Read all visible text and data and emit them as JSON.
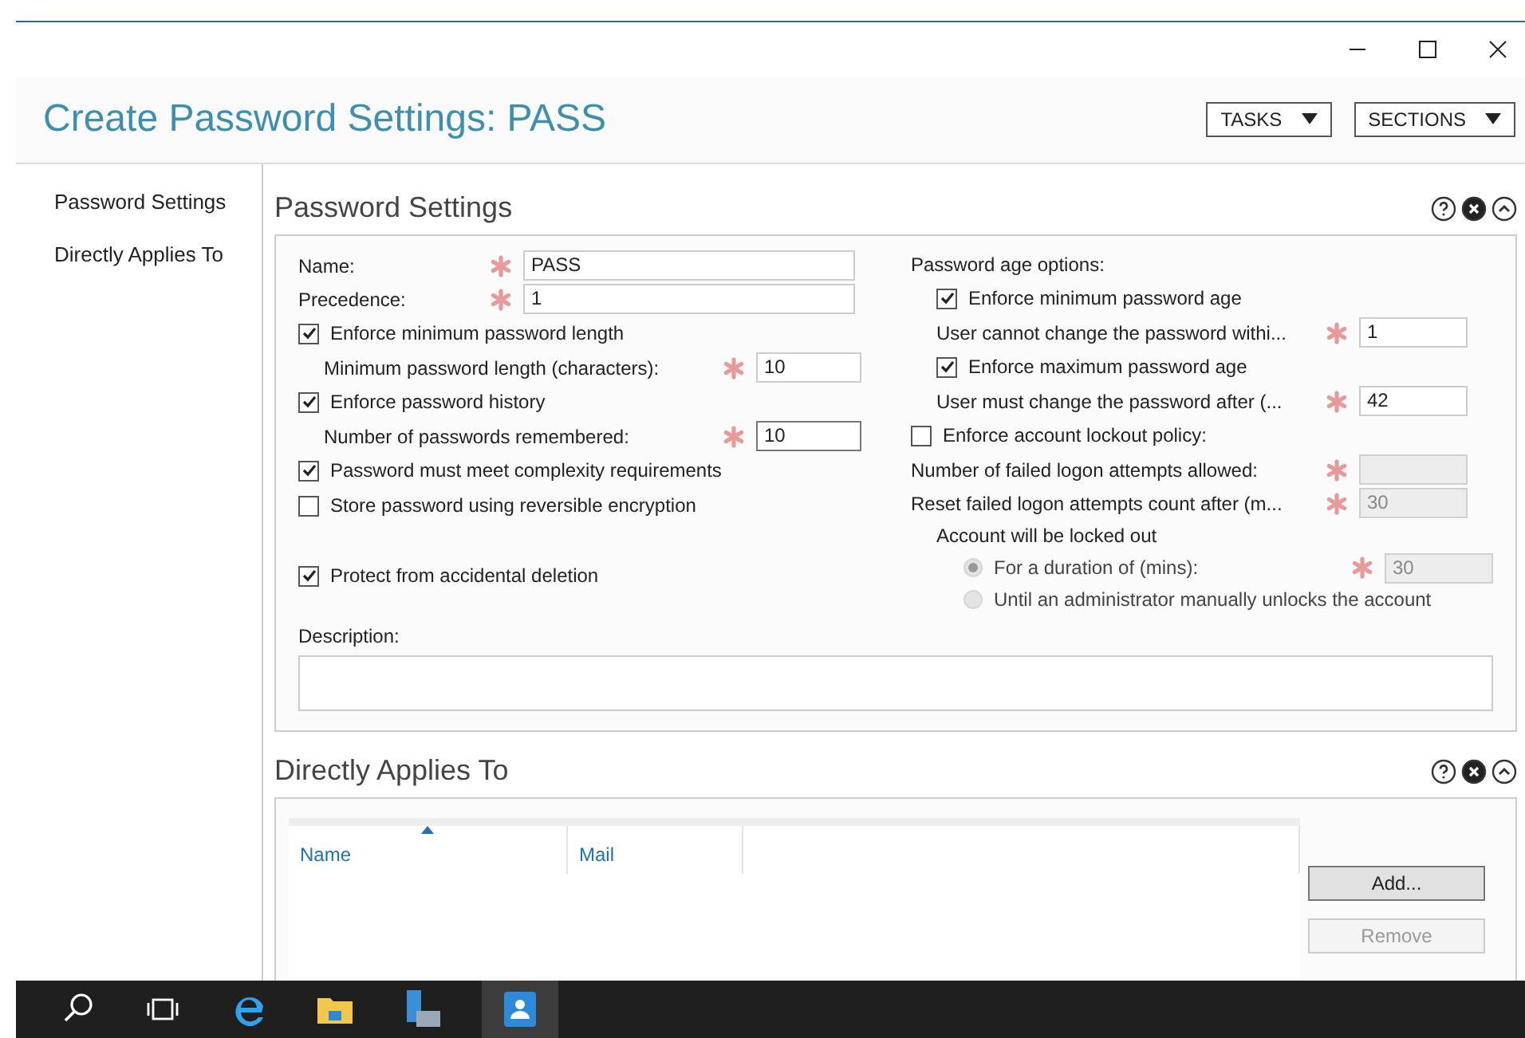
{
  "window": {
    "title": "Create Password Settings: PASS"
  },
  "header_buttons": [
    {
      "label": "TASKS"
    },
    {
      "label": "SECTIONS"
    }
  ],
  "sidebar": {
    "items": [
      {
        "label": "Password Settings"
      },
      {
        "label": "Directly Applies To"
      }
    ]
  },
  "password_settings": {
    "title": "Password Settings",
    "left": [
      {
        "kind": "field",
        "label": "Name:",
        "value": "PASS",
        "required": true
      },
      {
        "kind": "field",
        "label": "Precedence:",
        "value": "1",
        "required": true
      },
      {
        "kind": "check",
        "label": "Enforce minimum password length",
        "checked": true
      },
      {
        "kind": "subfield",
        "label": "Minimum password length (characters):",
        "value": "10",
        "required": true
      },
      {
        "kind": "check",
        "label": "Enforce password history",
        "checked": true
      },
      {
        "kind": "subfield",
        "label": "Number of passwords remembered:",
        "value": "10",
        "required": true,
        "focused": true
      },
      {
        "kind": "check",
        "label": "Password must meet complexity requirements",
        "checked": true
      },
      {
        "kind": "check",
        "label": "Store password using reversible encryption",
        "checked": false
      },
      {
        "kind": "spacer"
      },
      {
        "kind": "check",
        "label": "Protect from accidental deletion",
        "checked": true
      }
    ],
    "right": [
      {
        "kind": "heading",
        "label": "Password age options:"
      },
      {
        "kind": "subcheck",
        "label": "Enforce minimum password age",
        "checked": true
      },
      {
        "kind": "subfield",
        "label": "User cannot change the password withi...",
        "value": "1",
        "required": true,
        "disabled": false
      },
      {
        "kind": "subcheck",
        "label": "Enforce maximum password age",
        "checked": true
      },
      {
        "kind": "subfield",
        "label": "User must change the password after (...",
        "value": "42",
        "required": true,
        "disabled": false
      },
      {
        "kind": "check",
        "label": "Enforce account lockout policy:",
        "checked": false
      },
      {
        "kind": "field",
        "label": "Number of failed logon attempts allowed:",
        "required": true,
        "disabled": true
      },
      {
        "kind": "field",
        "label": "Reset failed logon attempts count after (m...",
        "value": "30",
        "required": true,
        "disabled": true
      },
      {
        "kind": "heading2",
        "label": "Account will be locked out"
      },
      {
        "kind": "radio",
        "label": "For a duration of (mins):",
        "selected": true,
        "value": "30",
        "required": true
      },
      {
        "kind": "radio",
        "label": "Until an administrator manually unlocks the account",
        "selected": false
      }
    ],
    "description": {
      "label": "Description:"
    }
  },
  "directly_applies_to": {
    "title": "Directly Applies To",
    "table": {
      "columns": [
        {
          "label": "Name",
          "sorted": true
        },
        {
          "label": "Mail",
          "sorted": false
        }
      ]
    },
    "buttons": [
      {
        "label": "Add...",
        "disabled": false
      },
      {
        "label": "Remove",
        "disabled": true
      }
    ]
  }
}
